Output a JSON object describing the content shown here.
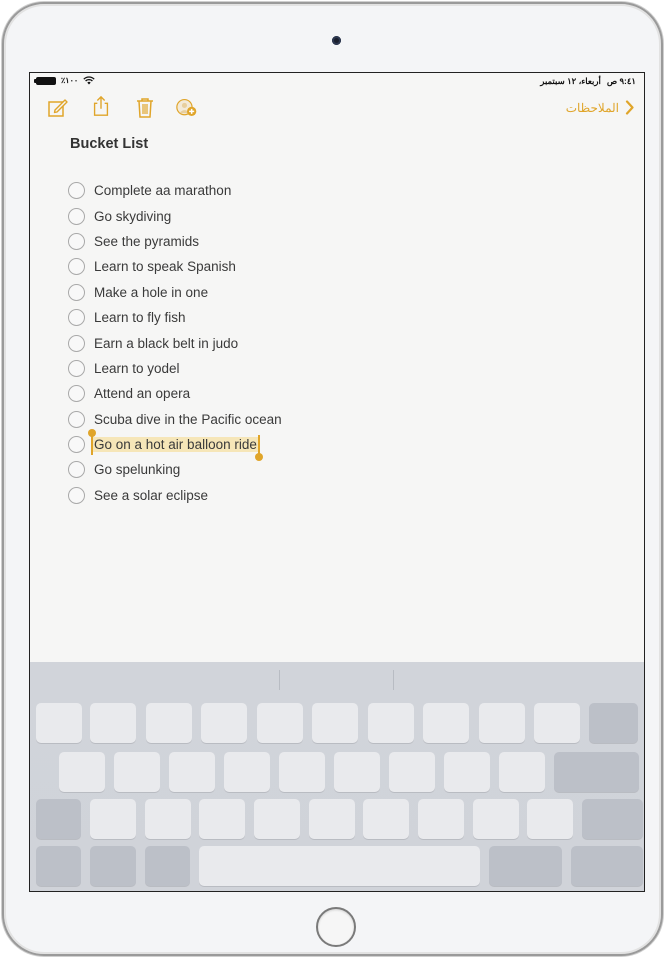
{
  "status_bar": {
    "battery_percent": "٪١٠٠",
    "battery_level": 1.0,
    "wifi_icon": "wifi-icon",
    "time": "٩:٤١ ص",
    "date": "أربعاء، ١٢ سبتمبر"
  },
  "toolbar": {
    "compose_icon": "compose-icon",
    "share_icon": "share-icon",
    "trash_icon": "trash-icon",
    "add_person_icon": "add-person-icon",
    "back_label": "الملاحظات",
    "back_icon": "chevron-icon"
  },
  "note": {
    "title": "Bucket List",
    "items": [
      {
        "text": "Complete aa marathon",
        "checked": false
      },
      {
        "text": "Go skydiving",
        "checked": false
      },
      {
        "text": "See the pyramids",
        "checked": false
      },
      {
        "text": "Learn to speak Spanish",
        "checked": false
      },
      {
        "text": "Make a hole in one",
        "checked": false
      },
      {
        "text": "Learn to fly fish",
        "checked": false
      },
      {
        "text": "Earn a black belt in judo",
        "checked": false
      },
      {
        "text": "Learn to yodel",
        "checked": false
      },
      {
        "text": "Attend an opera",
        "checked": false
      },
      {
        "text": "Scuba dive in the Pacific ocean",
        "checked": false
      },
      {
        "text": "Go on a hot air balloon ride",
        "checked": false,
        "selected": true
      },
      {
        "text": "Go spelunking",
        "checked": false
      },
      {
        "text": "See a solar eclipse",
        "checked": false
      }
    ]
  },
  "colors": {
    "accent": "#e0a52a",
    "selection": "#f6e6b8",
    "text": "#3a3a3a",
    "keyboard_bg": "#d1d4da",
    "key": "#e9eaed",
    "function_key": "#bcc0c8"
  },
  "keyboard": {
    "suggestions": [
      "",
      "",
      ""
    ],
    "key_labels_visible": false
  }
}
